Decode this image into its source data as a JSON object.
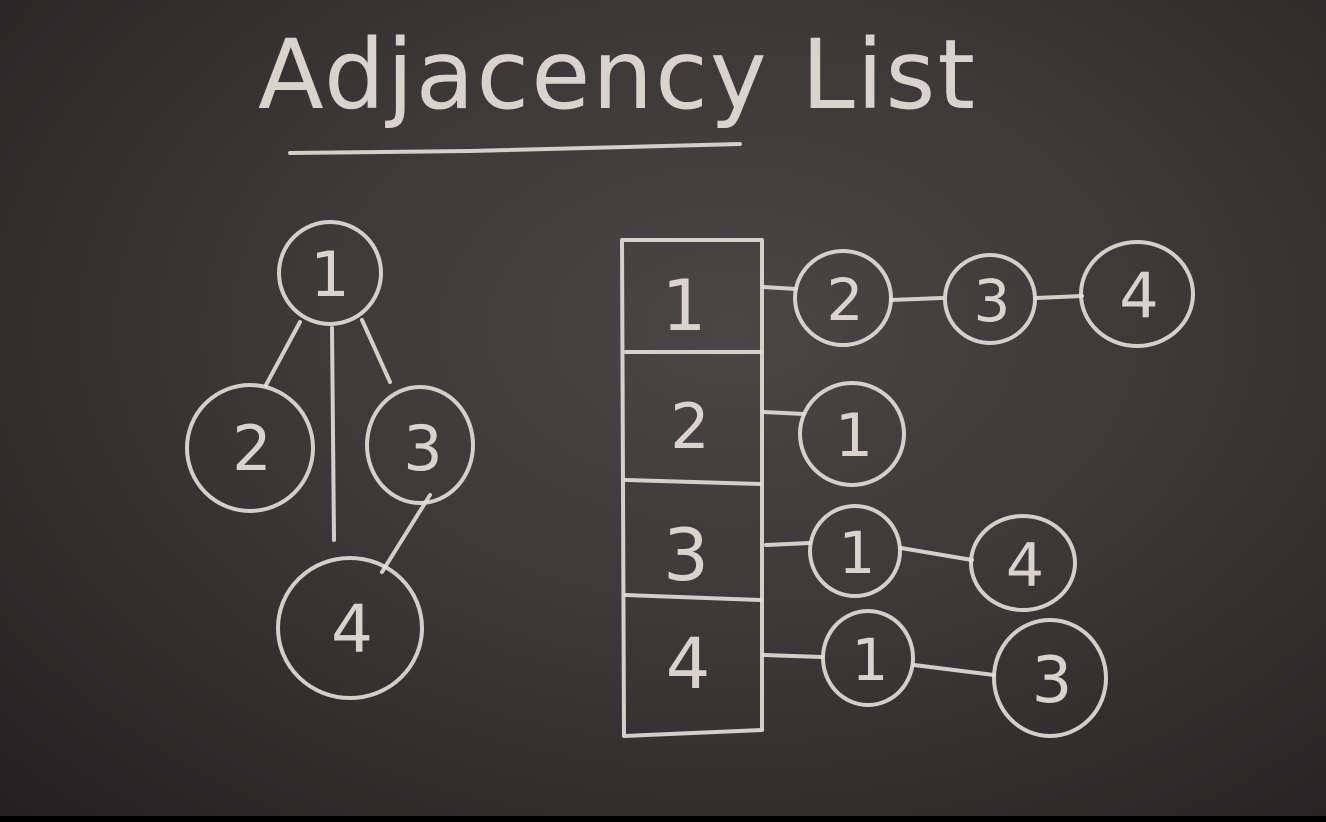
{
  "title": "Adjacency List",
  "graph": {
    "nodes": [
      "1",
      "2",
      "3",
      "4"
    ]
  },
  "list": {
    "rows": [
      {
        "vertex": "1",
        "neighbors": [
          "2",
          "3",
          "4"
        ]
      },
      {
        "vertex": "2",
        "neighbors": [
          "1"
        ]
      },
      {
        "vertex": "3",
        "neighbors": [
          "1",
          "4"
        ]
      },
      {
        "vertex": "4",
        "neighbors": [
          "1",
          "3"
        ]
      }
    ]
  }
}
